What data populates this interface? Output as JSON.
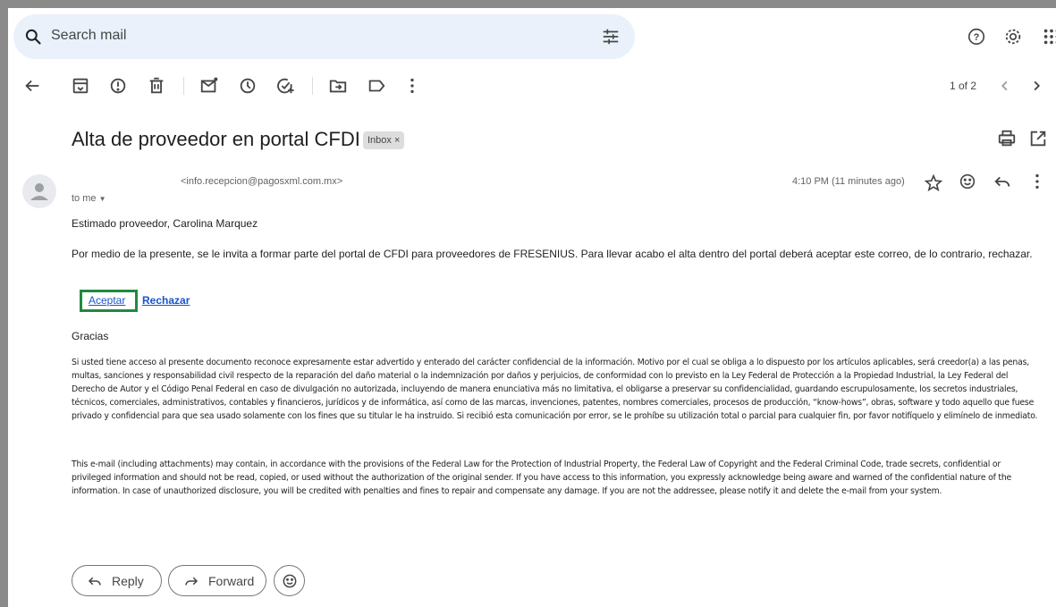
{
  "search": {
    "placeholder": "Search mail"
  },
  "toolbar": {
    "back": "arrow-back-icon",
    "actions": [
      "archive-icon",
      "report-spam-icon",
      "delete-icon",
      "mark-unread-icon",
      "snooze-icon",
      "add-task-icon",
      "move-to-icon",
      "label-icon",
      "more-icon"
    ],
    "pager": "1 of 2"
  },
  "email": {
    "subject": "Alta de proveedor en portal CFDI",
    "label": "Inbox ×",
    "sender_email": "<info.recepcion@pagosxml.com.mx>",
    "recipient": "to me",
    "time": "4:10 PM (11 minutes ago)",
    "greeting": "Estimado proveedor, Carolina Marquez",
    "paragraph": "Por medio de la presente, se le invita a formar parte del portal de CFDI para proveedores de FRESENIUS. Para llevar acabo el alta dentro del portal deberá aceptar este correo, de lo contrario, rechazar.",
    "accept_label": "Aceptar",
    "reject_label": "Rechazar",
    "thanks": "Gracias",
    "legal_es": "Si usted tiene acceso al presente documento reconoce expresamente estar advertido y enterado del carácter confidencial de la información. Motivo por el cual se obliga a lo dispuesto por los artículos aplicables, será creedor(a) a las penas, multas, sanciones y responsabilidad civil respecto de la reparación del daño material o la indemnización por daños y perjuicios, de conformidad con lo previsto en la Ley Federal de Protección a la Propiedad Industrial, la Ley Federal del Derecho de Autor y el Código Penal Federal en caso de divulgación no autorizada, incluyendo de manera enunciativa más no limitativa, el obligarse a preservar su confidencialidad, guardando escrupulosamente, los secretos industriales, técnicos, comerciales, administrativos, contables y financieros, jurídicos y de informática, así como de las marcas, invenciones, patentes, nombres comerciales, procesos de producción, “know-hows”, obras, software y todo aquello que fuese privado y confidencial para que sea usado solamente con los fines que su titular le ha instruido. Si recibió esta comunicación por error, se le prohíbe su utilización total o parcial para cualquier fin, por favor notifíquelo y elimínelo de inmediato.",
    "legal_en": "This e-mail (including attachments) may contain, in accordance with the provisions of the Federal Law for the Protection of Industrial Property, the Federal Law of Copyright and the Federal Criminal Code, trade secrets, confidential or privileged information and should not be read, copied, or used without the authorization of the original sender. If you have access to this information, you expressly acknowledge being aware and warned of the confidential nature of the information. In case of unauthorized disclosure, you will be credited with penalties and fines to repair and compensate any damage. If you are not the addressee, please notify it and delete the e-mail from your system."
  },
  "footer": {
    "reply_label": "Reply",
    "forward_label": "Forward"
  },
  "colors": {
    "accent": "#1a55c9",
    "highlight_box": "#1f8a3e",
    "search_bg": "#eaf1fb"
  }
}
